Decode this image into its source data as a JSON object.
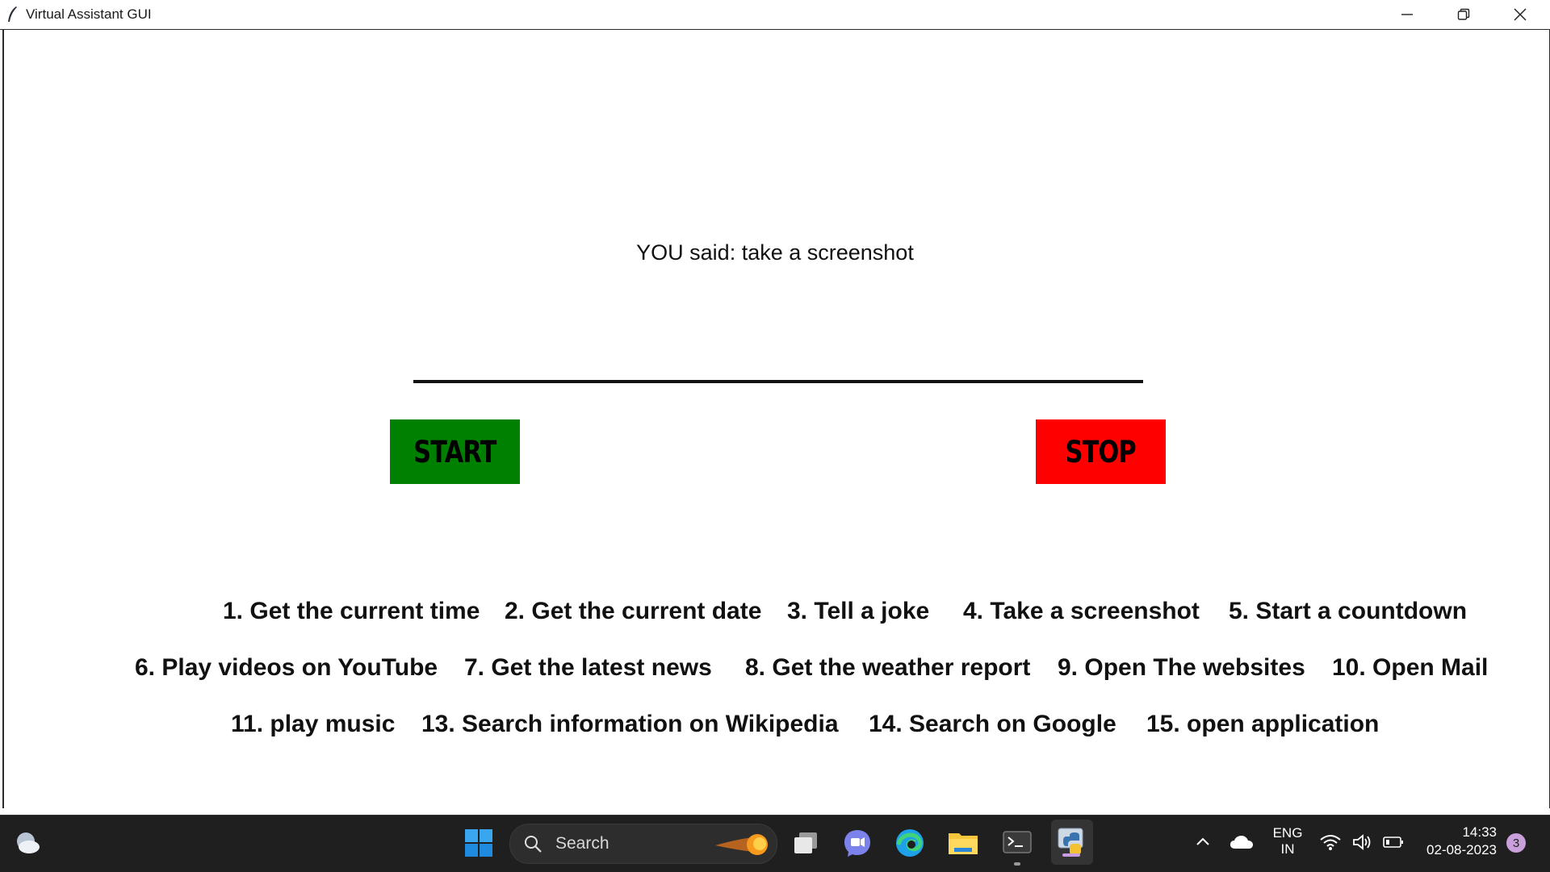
{
  "window": {
    "title": "Virtual Assistant GUI"
  },
  "main": {
    "you_said": "YOU said: take a screenshot",
    "start_label": "START",
    "stop_label": "STOP",
    "start_color": "#008000",
    "stop_color": "#ff0000"
  },
  "commands": {
    "row1": [
      "1. Get the current time",
      "2. Get the current date",
      "3. Tell a joke",
      "4. Take a screenshot",
      "5. Start a countdown"
    ],
    "row2": [
      "6. Play videos on YouTube",
      "7. Get the latest news",
      "8. Get the weather report",
      "9. Open The websites",
      "10. Open Mail"
    ],
    "row3": [
      "11. play music",
      "13. Search information on Wikipedia",
      "14. Search on Google",
      "15. open application"
    ]
  },
  "taskbar": {
    "search_placeholder": "Search",
    "language_line1": "ENG",
    "language_line2": "IN",
    "time": "14:33",
    "date": "02-08-2023",
    "notification_count": "3",
    "icons": [
      "weather-icon",
      "windows-start-icon",
      "search-icon",
      "task-view-icon",
      "teams-chat-icon",
      "edge-browser-icon",
      "file-explorer-icon",
      "terminal-icon",
      "python-icon",
      "tray-chevron-icon",
      "onedrive-cloud-icon",
      "wifi-icon",
      "volume-icon",
      "battery-icon"
    ]
  }
}
